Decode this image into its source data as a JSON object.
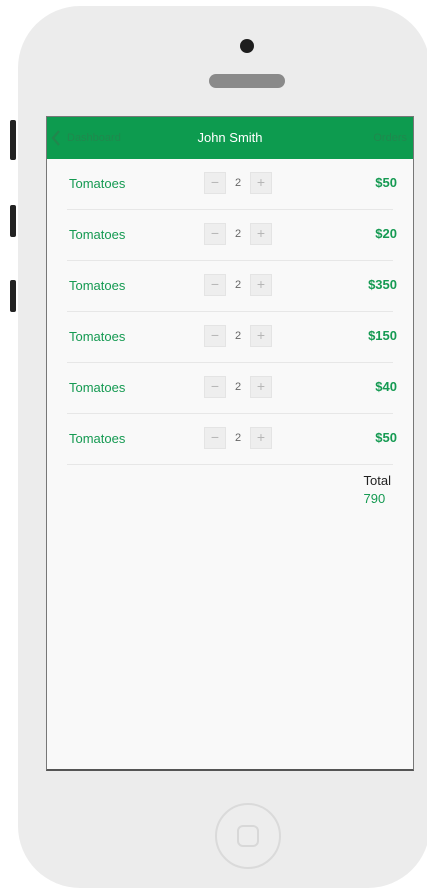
{
  "header": {
    "back_label": "Dashboard",
    "title": "John Smith",
    "right_label": "Orders"
  },
  "items": [
    {
      "name": "Tomatoes",
      "qty": "2",
      "price": "$50"
    },
    {
      "name": "Tomatoes",
      "qty": "2",
      "price": "$20"
    },
    {
      "name": "Tomatoes",
      "qty": "2",
      "price": "$350"
    },
    {
      "name": "Tomatoes",
      "qty": "2",
      "price": "$150"
    },
    {
      "name": "Tomatoes",
      "qty": "2",
      "price": "$40"
    },
    {
      "name": "Tomatoes",
      "qty": "2",
      "price": "$50"
    }
  ],
  "stepper": {
    "minus": "−",
    "plus": "+"
  },
  "total": {
    "label": "Total",
    "value": "790"
  },
  "icons": {
    "back": "chevron-left-icon",
    "camera": "camera-dot",
    "home": "home-button"
  },
  "colors": {
    "accent": "#0d9b4f",
    "text_green": "#159a52"
  }
}
